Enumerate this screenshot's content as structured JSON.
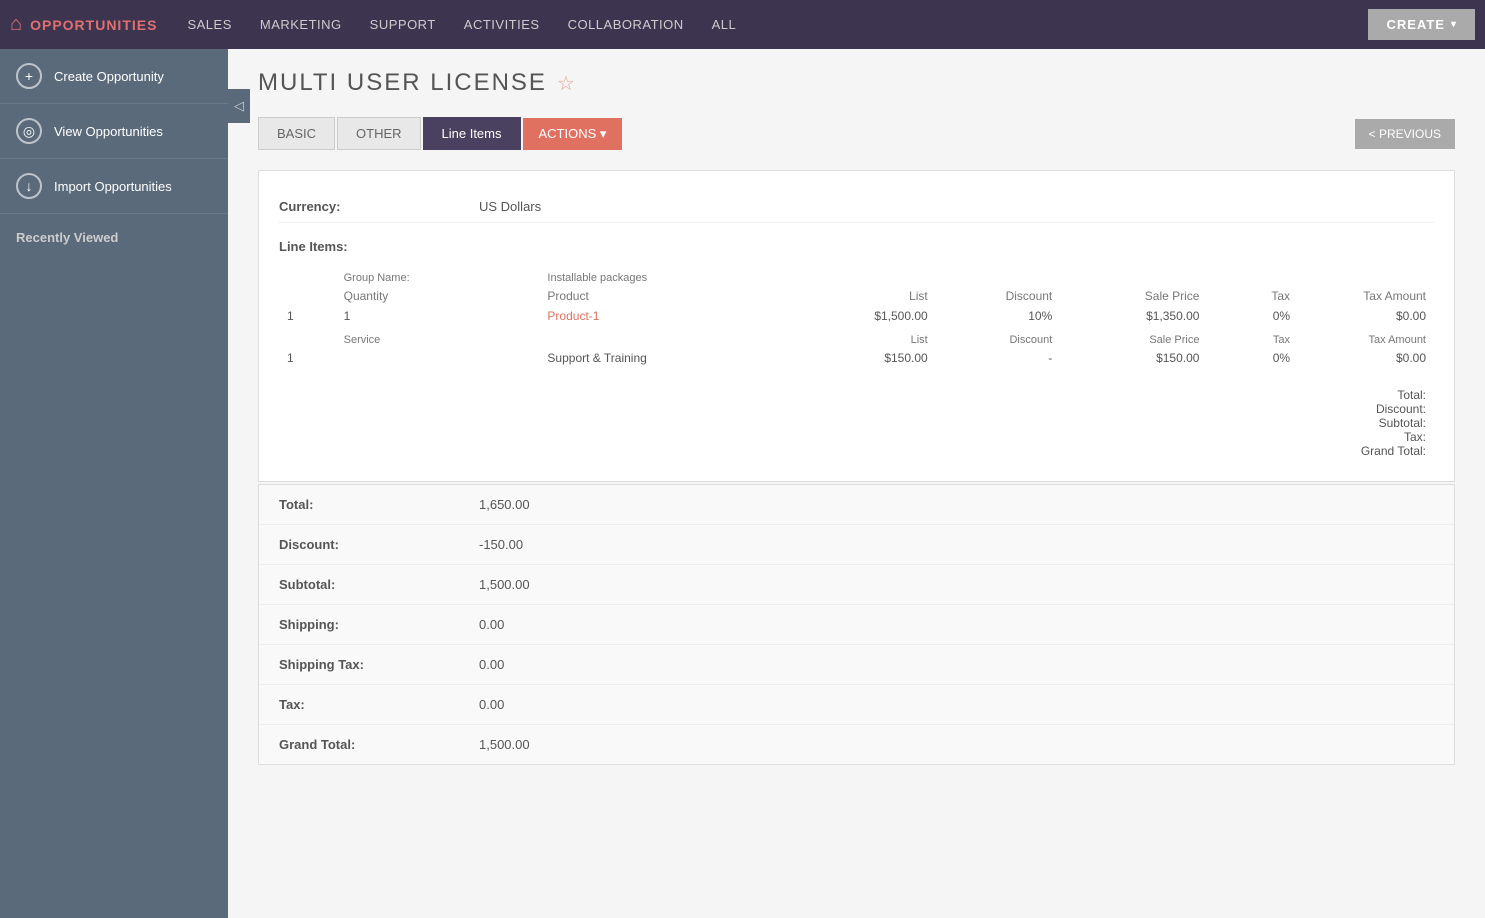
{
  "topnav": {
    "brand": "OPPORTUNITIES",
    "items": [
      {
        "label": "SALES"
      },
      {
        "label": "MARKETING"
      },
      {
        "label": "SUPPORT"
      },
      {
        "label": "ACTIVITIES"
      },
      {
        "label": "COLLABORATION"
      },
      {
        "label": "ALL"
      }
    ],
    "create_label": "CREATE"
  },
  "sidebar": {
    "items": [
      {
        "label": "Create Opportunity",
        "icon": "+"
      },
      {
        "label": "View Opportunities",
        "icon": "👁"
      },
      {
        "label": "Import Opportunities",
        "icon": "↓"
      }
    ],
    "recently_viewed_label": "Recently Viewed"
  },
  "page": {
    "title": "MULTI USER LICENSE",
    "tabs": [
      {
        "label": "BASIC"
      },
      {
        "label": "OTHER"
      },
      {
        "label": "Line Items",
        "active": true
      },
      {
        "label": "ACTIONS ▾",
        "type": "actions"
      }
    ],
    "prev_label": "< PREVIOUS"
  },
  "currency": {
    "label": "Currency:",
    "value": "US Dollars"
  },
  "line_items": {
    "header": "Line Items:",
    "groups": [
      {
        "name": "Installable packages",
        "items": [
          {
            "quantity": "1",
            "product": "Product-1",
            "list": "$1,500.00",
            "discount": "10%",
            "sale_price": "$1,350.00",
            "tax": "0%",
            "tax_amount": "$0.00"
          }
        ]
      },
      {
        "name": "Service",
        "items": [
          {
            "quantity": "1",
            "product": "Support & Training",
            "list": "$150.00",
            "discount": "-",
            "sale_price": "$150.00",
            "tax": "0%",
            "tax_amount": "$0.00"
          }
        ]
      }
    ],
    "summary_labels": {
      "total": "Total:",
      "discount": "Discount:",
      "subtotal": "Subtotal:",
      "tax": "Tax:",
      "grand_total": "Grand Total:"
    }
  },
  "summary": {
    "total_label": "Total:",
    "total_value": "1,650.00",
    "discount_label": "Discount:",
    "discount_value": "-150.00",
    "subtotal_label": "Subtotal:",
    "subtotal_value": "1,500.00",
    "shipping_label": "Shipping:",
    "shipping_value": "0.00",
    "shipping_tax_label": "Shipping Tax:",
    "shipping_tax_value": "0.00",
    "tax_label": "Tax:",
    "tax_value": "0.00",
    "grand_total_label": "Grand Total:",
    "grand_total_value": "1,500.00"
  }
}
